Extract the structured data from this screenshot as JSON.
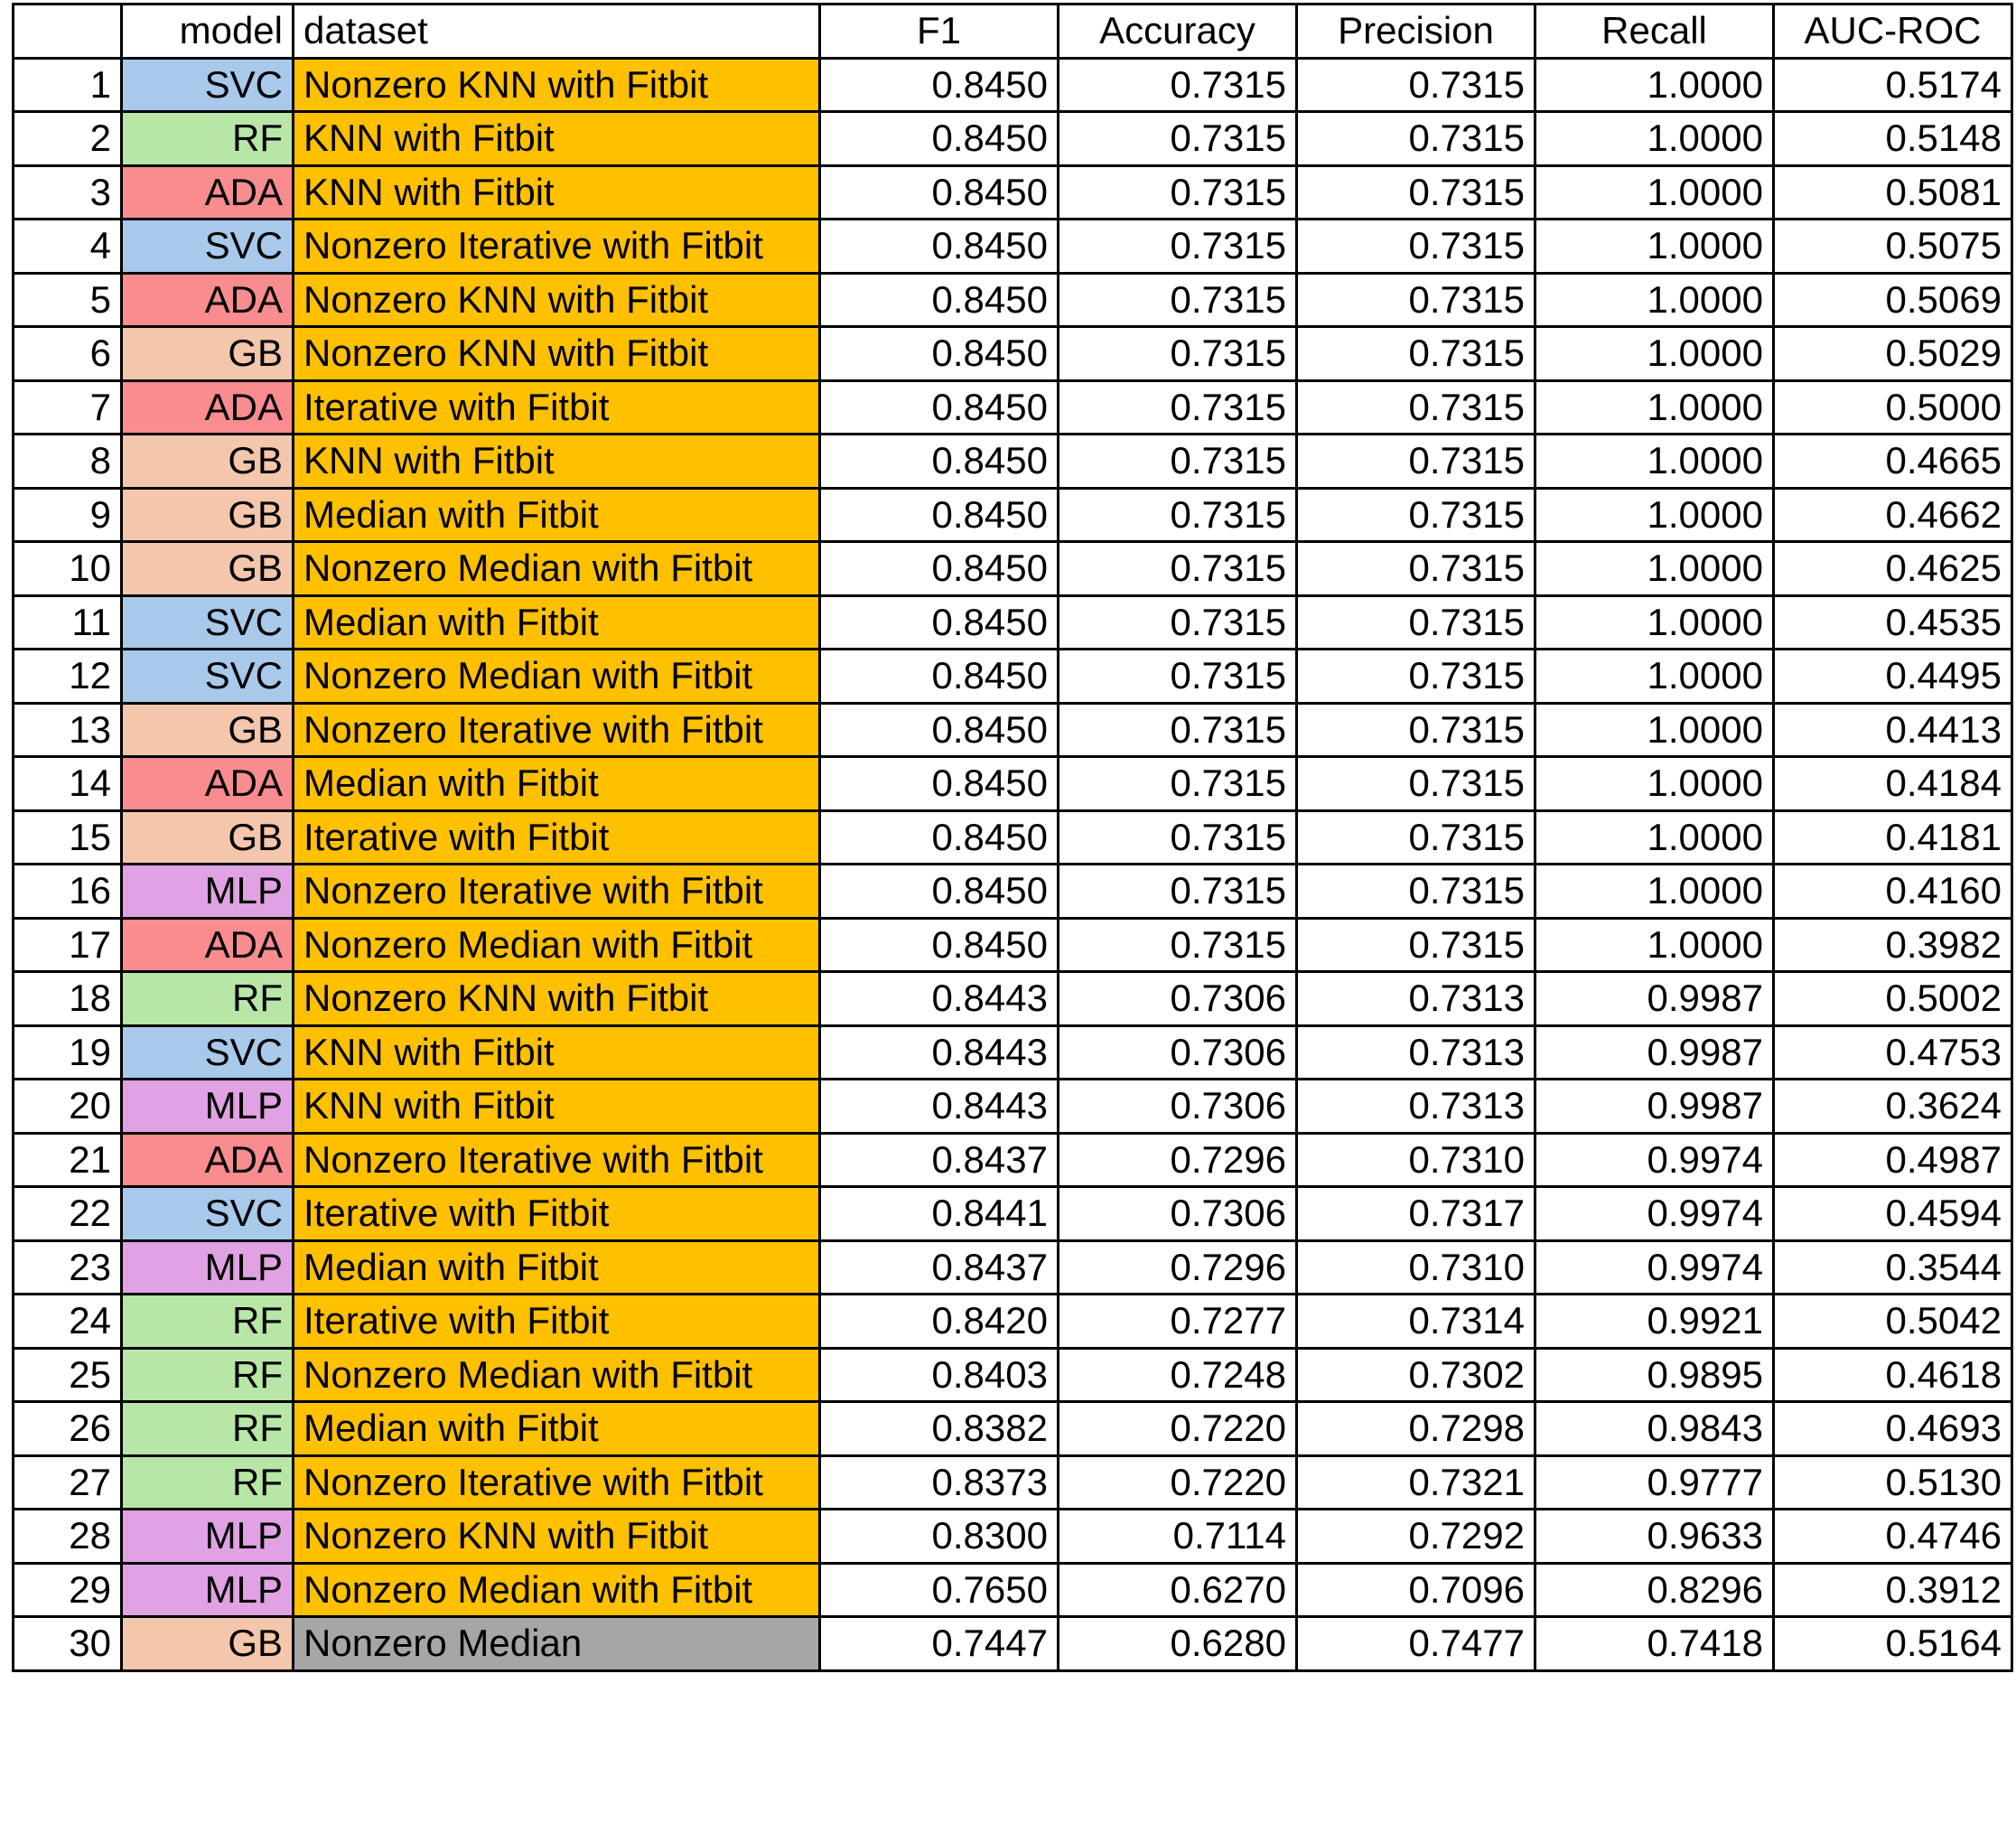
{
  "colors": {
    "SVC": "#a8c9ea",
    "RF": "#b8e6a6",
    "ADA": "#f98c8f",
    "GB": "#f4c6ac",
    "MLP": "#e0a2e2",
    "dataset_fitbit": "#ffc000",
    "dataset_plain": "#a6a6a6"
  },
  "header": {
    "index": "",
    "model": "model",
    "dataset": "dataset",
    "f1": "F1",
    "accuracy": "Accuracy",
    "precision": "Precision",
    "recall": "Recall",
    "auc_roc": "AUC-ROC"
  },
  "rows": [
    {
      "idx": "1",
      "model": "SVC",
      "dataset": "Nonzero KNN with Fitbit",
      "f1": "0.8450",
      "accuracy": "0.7315",
      "precision": "0.7315",
      "recall": "1.0000",
      "auc": "0.5174",
      "fitbit": true
    },
    {
      "idx": "2",
      "model": "RF",
      "dataset": "KNN with Fitbit",
      "f1": "0.8450",
      "accuracy": "0.7315",
      "precision": "0.7315",
      "recall": "1.0000",
      "auc": "0.5148",
      "fitbit": true
    },
    {
      "idx": "3",
      "model": "ADA",
      "dataset": "KNN with Fitbit",
      "f1": "0.8450",
      "accuracy": "0.7315",
      "precision": "0.7315",
      "recall": "1.0000",
      "auc": "0.5081",
      "fitbit": true
    },
    {
      "idx": "4",
      "model": "SVC",
      "dataset": "Nonzero Iterative with Fitbit",
      "f1": "0.8450",
      "accuracy": "0.7315",
      "precision": "0.7315",
      "recall": "1.0000",
      "auc": "0.5075",
      "fitbit": true
    },
    {
      "idx": "5",
      "model": "ADA",
      "dataset": "Nonzero KNN with Fitbit",
      "f1": "0.8450",
      "accuracy": "0.7315",
      "precision": "0.7315",
      "recall": "1.0000",
      "auc": "0.5069",
      "fitbit": true
    },
    {
      "idx": "6",
      "model": "GB",
      "dataset": "Nonzero KNN with Fitbit",
      "f1": "0.8450",
      "accuracy": "0.7315",
      "precision": "0.7315",
      "recall": "1.0000",
      "auc": "0.5029",
      "fitbit": true
    },
    {
      "idx": "7",
      "model": "ADA",
      "dataset": "Iterative with Fitbit",
      "f1": "0.8450",
      "accuracy": "0.7315",
      "precision": "0.7315",
      "recall": "1.0000",
      "auc": "0.5000",
      "fitbit": true
    },
    {
      "idx": "8",
      "model": "GB",
      "dataset": "KNN with Fitbit",
      "f1": "0.8450",
      "accuracy": "0.7315",
      "precision": "0.7315",
      "recall": "1.0000",
      "auc": "0.4665",
      "fitbit": true
    },
    {
      "idx": "9",
      "model": "GB",
      "dataset": "Median with Fitbit",
      "f1": "0.8450",
      "accuracy": "0.7315",
      "precision": "0.7315",
      "recall": "1.0000",
      "auc": "0.4662",
      "fitbit": true
    },
    {
      "idx": "10",
      "model": "GB",
      "dataset": "Nonzero Median with Fitbit",
      "f1": "0.8450",
      "accuracy": "0.7315",
      "precision": "0.7315",
      "recall": "1.0000",
      "auc": "0.4625",
      "fitbit": true
    },
    {
      "idx": "11",
      "model": "SVC",
      "dataset": "Median with Fitbit",
      "f1": "0.8450",
      "accuracy": "0.7315",
      "precision": "0.7315",
      "recall": "1.0000",
      "auc": "0.4535",
      "fitbit": true
    },
    {
      "idx": "12",
      "model": "SVC",
      "dataset": "Nonzero Median with Fitbit",
      "f1": "0.8450",
      "accuracy": "0.7315",
      "precision": "0.7315",
      "recall": "1.0000",
      "auc": "0.4495",
      "fitbit": true
    },
    {
      "idx": "13",
      "model": "GB",
      "dataset": "Nonzero Iterative with Fitbit",
      "f1": "0.8450",
      "accuracy": "0.7315",
      "precision": "0.7315",
      "recall": "1.0000",
      "auc": "0.4413",
      "fitbit": true
    },
    {
      "idx": "14",
      "model": "ADA",
      "dataset": "Median with Fitbit",
      "f1": "0.8450",
      "accuracy": "0.7315",
      "precision": "0.7315",
      "recall": "1.0000",
      "auc": "0.4184",
      "fitbit": true
    },
    {
      "idx": "15",
      "model": "GB",
      "dataset": "Iterative with Fitbit",
      "f1": "0.8450",
      "accuracy": "0.7315",
      "precision": "0.7315",
      "recall": "1.0000",
      "auc": "0.4181",
      "fitbit": true
    },
    {
      "idx": "16",
      "model": "MLP",
      "dataset": "Nonzero Iterative with Fitbit",
      "f1": "0.8450",
      "accuracy": "0.7315",
      "precision": "0.7315",
      "recall": "1.0000",
      "auc": "0.4160",
      "fitbit": true
    },
    {
      "idx": "17",
      "model": "ADA",
      "dataset": "Nonzero Median with Fitbit",
      "f1": "0.8450",
      "accuracy": "0.7315",
      "precision": "0.7315",
      "recall": "1.0000",
      "auc": "0.3982",
      "fitbit": true
    },
    {
      "idx": "18",
      "model": "RF",
      "dataset": "Nonzero KNN with Fitbit",
      "f1": "0.8443",
      "accuracy": "0.7306",
      "precision": "0.7313",
      "recall": "0.9987",
      "auc": "0.5002",
      "fitbit": true
    },
    {
      "idx": "19",
      "model": "SVC",
      "dataset": "KNN with Fitbit",
      "f1": "0.8443",
      "accuracy": "0.7306",
      "precision": "0.7313",
      "recall": "0.9987",
      "auc": "0.4753",
      "fitbit": true
    },
    {
      "idx": "20",
      "model": "MLP",
      "dataset": "KNN with Fitbit",
      "f1": "0.8443",
      "accuracy": "0.7306",
      "precision": "0.7313",
      "recall": "0.9987",
      "auc": "0.3624",
      "fitbit": true
    },
    {
      "idx": "21",
      "model": "ADA",
      "dataset": "Nonzero Iterative with Fitbit",
      "f1": "0.8437",
      "accuracy": "0.7296",
      "precision": "0.7310",
      "recall": "0.9974",
      "auc": "0.4987",
      "fitbit": true
    },
    {
      "idx": "22",
      "model": "SVC",
      "dataset": "Iterative with Fitbit",
      "f1": "0.8441",
      "accuracy": "0.7306",
      "precision": "0.7317",
      "recall": "0.9974",
      "auc": "0.4594",
      "fitbit": true
    },
    {
      "idx": "23",
      "model": "MLP",
      "dataset": "Median with Fitbit",
      "f1": "0.8437",
      "accuracy": "0.7296",
      "precision": "0.7310",
      "recall": "0.9974",
      "auc": "0.3544",
      "fitbit": true
    },
    {
      "idx": "24",
      "model": "RF",
      "dataset": "Iterative with Fitbit",
      "f1": "0.8420",
      "accuracy": "0.7277",
      "precision": "0.7314",
      "recall": "0.9921",
      "auc": "0.5042",
      "fitbit": true
    },
    {
      "idx": "25",
      "model": "RF",
      "dataset": "Nonzero Median with Fitbit",
      "f1": "0.8403",
      "accuracy": "0.7248",
      "precision": "0.7302",
      "recall": "0.9895",
      "auc": "0.4618",
      "fitbit": true
    },
    {
      "idx": "26",
      "model": "RF",
      "dataset": "Median with Fitbit",
      "f1": "0.8382",
      "accuracy": "0.7220",
      "precision": "0.7298",
      "recall": "0.9843",
      "auc": "0.4693",
      "fitbit": true
    },
    {
      "idx": "27",
      "model": "RF",
      "dataset": "Nonzero Iterative with Fitbit",
      "f1": "0.8373",
      "accuracy": "0.7220",
      "precision": "0.7321",
      "recall": "0.9777",
      "auc": "0.5130",
      "fitbit": true
    },
    {
      "idx": "28",
      "model": "MLP",
      "dataset": "Nonzero KNN with Fitbit",
      "f1": "0.8300",
      "accuracy": "0.7114",
      "precision": "0.7292",
      "recall": "0.9633",
      "auc": "0.4746",
      "fitbit": true
    },
    {
      "idx": "29",
      "model": "MLP",
      "dataset": "Nonzero Median with Fitbit",
      "f1": "0.7650",
      "accuracy": "0.6270",
      "precision": "0.7096",
      "recall": "0.8296",
      "auc": "0.3912",
      "fitbit": true
    },
    {
      "idx": "30",
      "model": "GB",
      "dataset": "Nonzero Median",
      "f1": "0.7447",
      "accuracy": "0.6280",
      "precision": "0.7477",
      "recall": "0.7418",
      "auc": "0.5164",
      "fitbit": false
    }
  ]
}
